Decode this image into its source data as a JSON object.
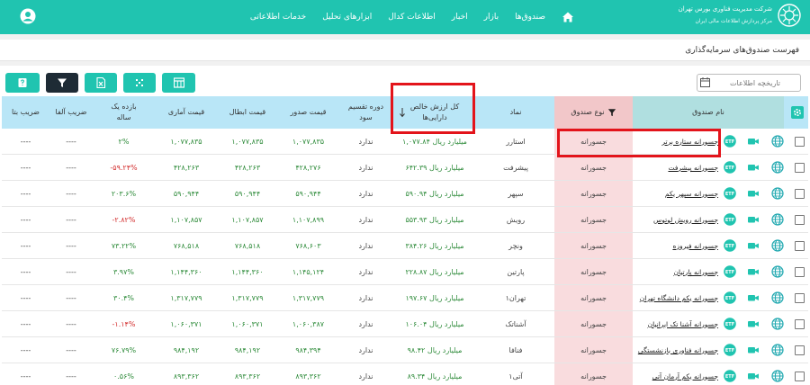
{
  "header": {
    "brand_line1": "شرکت مدیریت فناوری بورس تهران",
    "brand_line2": "مرکز پردازش اطلاعات مالی ایران",
    "nav": [
      "صندوق‌ها",
      "بازار",
      "اخبار",
      "اطلاعات کدال",
      "ابزارهای تحلیل",
      "خدمات اطلاعاتی"
    ]
  },
  "page": {
    "title": "فهرست صندوق‌های سرمایه‌گذاری"
  },
  "toolbar": {
    "date_placeholder": "تاریخچه اطلاعات"
  },
  "table": {
    "columns": {
      "name": "نام صندوق",
      "type": "نوع صندوق",
      "symbol": "نماد",
      "nav": "کل ارزش خالص دارایی‌ها",
      "dividend": "دوره تقسیم سود",
      "issue": "قیمت صدور",
      "cancel": "قیمت ابطال",
      "stat": "قیمت آماری",
      "return1y": "بازده یک ساله",
      "alpha": "ضریب آلفا",
      "beta": "ضریب بتا"
    },
    "rows": [
      {
        "name": "جسورانه ستاره برتر",
        "type": "جسورانه",
        "symbol": "استارر",
        "nav": "۱,۰۷۷.۸۴ میلیارد ریال",
        "dividend": "ندارد",
        "issue": "۱,۰۷۷,۸۳۵",
        "cancel": "۱,۰۷۷,۸۳۵",
        "stat": "۱,۰۷۷,۸۳۵",
        "return1y": "۲%",
        "return_color": "green",
        "alpha": "----",
        "beta": "----"
      },
      {
        "name": "جسورانه پیشرفت",
        "type": "جسورانه",
        "symbol": "پیشرفت",
        "nav": "۶۴۲.۳۹ میلیارد ریال",
        "dividend": "ندارد",
        "issue": "۴۲۸,۲۷۶",
        "cancel": "۴۲۸,۲۶۳",
        "stat": "۴۲۸,۲۶۳",
        "return1y": "-۵۹.۲۴%",
        "return_color": "red",
        "alpha": "----",
        "beta": "----"
      },
      {
        "name": "جسورانه سپهر یکم",
        "type": "جسورانه",
        "symbol": "سپهر",
        "nav": "۵۹۰.۹۴ میلیارد ریال",
        "dividend": "ندارد",
        "issue": "۵۹۰,۹۴۴",
        "cancel": "۵۹۰,۹۴۴",
        "stat": "۵۹۰,۹۴۴",
        "return1y": "۲۰۳.۶%",
        "return_color": "green",
        "alpha": "----",
        "beta": "----"
      },
      {
        "name": "جسورانه رویش لوتوس",
        "type": "جسورانه",
        "symbol": "رویش",
        "nav": "۵۵۳.۹۳ میلیارد ریال",
        "dividend": "ندارد",
        "issue": "۱,۱۰۷,۸۹۹",
        "cancel": "۱,۱۰۷,۸۵۷",
        "stat": "۱,۱۰۷,۸۵۷",
        "return1y": "-۲.۸۲%",
        "return_color": "red",
        "alpha": "----",
        "beta": "----"
      },
      {
        "name": "جسورانه فیروزه",
        "type": "جسورانه",
        "symbol": "ونچر",
        "nav": "۳۸۴.۲۶ میلیارد ریال",
        "dividend": "ندارد",
        "issue": "۷۶۸,۶۰۳",
        "cancel": "۷۶۸,۵۱۸",
        "stat": "۷۶۸,۵۱۸",
        "return1y": "۷۳.۲۲%",
        "return_color": "green",
        "alpha": "----",
        "beta": "----"
      },
      {
        "name": "جسورانه پارتیان",
        "type": "جسورانه",
        "symbol": "پارتین",
        "nav": "۲۲۸.۸۷ میلیارد ریال",
        "dividend": "ندارد",
        "issue": "۱,۱۴۵,۱۲۴",
        "cancel": "۱,۱۴۴,۳۶۰",
        "stat": "۱,۱۴۴,۳۶۰",
        "return1y": "۳.۹۷%",
        "return_color": "green",
        "alpha": "----",
        "beta": "----"
      },
      {
        "name": "جسورانه یکم دانشگاه تهران",
        "type": "جسورانه",
        "symbol": "تهران۱",
        "nav": "۱۹۷.۶۷ میلیارد ریال",
        "dividend": "ندارد",
        "issue": "۱,۳۱۷,۷۷۹",
        "cancel": "۱,۳۱۷,۷۷۹",
        "stat": "۱,۳۱۷,۷۷۹",
        "return1y": "۳۰.۴%",
        "return_color": "green",
        "alpha": "----",
        "beta": "----"
      },
      {
        "name": "جسورانه آشنا تک ایرانیان",
        "type": "جسورانه",
        "symbol": "آشناتک",
        "nav": "۱۰۶.۰۴ میلیارد ریال",
        "dividend": "ندارد",
        "issue": "۱,۰۶۰,۳۸۷",
        "cancel": "۱,۰۶۰,۳۷۱",
        "stat": "۱,۰۶۰,۳۷۱",
        "return1y": "-۱.۱۴%",
        "return_color": "red",
        "alpha": "----",
        "beta": "----"
      },
      {
        "name": "جسورانه فناوری بازنشستگی",
        "type": "جسورانه",
        "symbol": "فنافا",
        "nav": "۹۸.۴۲ میلیارد ریال",
        "dividend": "ندارد",
        "issue": "۹۸۴,۳۹۴",
        "cancel": "۹۸۴,۱۹۲",
        "stat": "۹۸۴,۱۹۲",
        "return1y": "۷۶.۷۹%",
        "return_color": "green",
        "alpha": "----",
        "beta": "----"
      },
      {
        "name": "جسورانه یکم آرمان آتی",
        "type": "جسورانه",
        "symbol": "آتی۱",
        "nav": "۸۹.۳۴ میلیارد ریال",
        "dividend": "ندارد",
        "issue": "۸۹۳,۳۶۲",
        "cancel": "۸۹۳,۳۶۲",
        "stat": "۸۹۳,۳۶۲",
        "return1y": "۰.۵۶%",
        "return_color": "green",
        "alpha": "----",
        "beta": "----"
      }
    ]
  },
  "colors": {
    "accent": "#20c4b0",
    "header_row": "#b9e6f7",
    "type_header": "#f2c7c9",
    "type_cell": "#f9dcde",
    "highlight": "#e3141b",
    "positive": "#2e8b3a",
    "negative": "#d32f2f"
  },
  "icons": [
    "home-icon",
    "user-icon",
    "calendar-icon",
    "table-icon",
    "grid-icon",
    "excel-icon",
    "filter-icon",
    "help-icon",
    "settings-icon",
    "globe-icon",
    "video-icon",
    "etf-icon",
    "sort-arrow-icon"
  ]
}
